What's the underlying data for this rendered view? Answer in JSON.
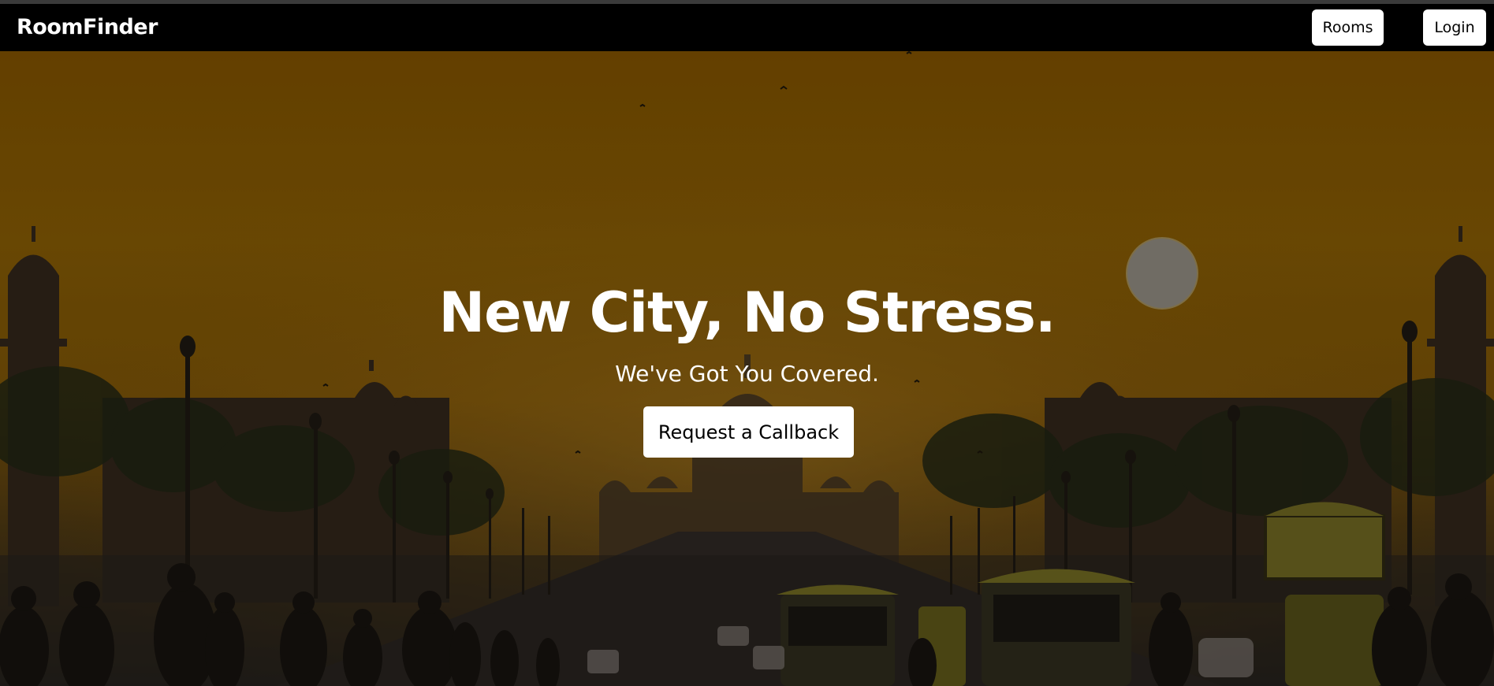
{
  "navbar": {
    "brand": "RoomFinder",
    "links": [
      {
        "label": "Rooms"
      },
      {
        "label": "Login"
      }
    ]
  },
  "hero": {
    "headline": "New City, No Stress.",
    "subheadline": "We've Got You Covered.",
    "cta_label": "Request a Callback",
    "background_icon": "city-sunset-photo"
  },
  "colors": {
    "navbar_bg": "#000000",
    "sky_top": "#7a4f00",
    "sky_mid": "#7d5604",
    "ground": "#2a241c",
    "button_bg": "#ffffff",
    "button_text": "#000000",
    "text": "#ffffff"
  }
}
